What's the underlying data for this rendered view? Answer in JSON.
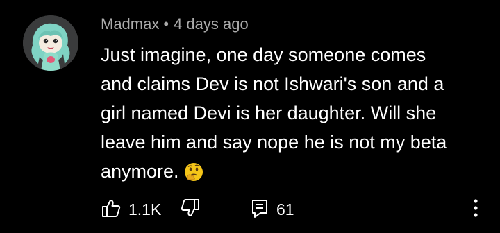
{
  "comment": {
    "author": "Madmax",
    "separator": "•",
    "timestamp": "4 days ago",
    "text_lines": [
      "Just imagine, one day someone comes",
      "and claims Dev is not Ishwari's son and a",
      "girl named Devi is her daughter. Will she",
      "leave him and say nope he is not my beta",
      "anymore."
    ],
    "emoji": "thinking-face-emoji",
    "likes": "1.1K",
    "replies": "61"
  },
  "icons": {
    "like": "thumbs-up-icon",
    "dislike": "thumbs-down-icon",
    "reply": "comment-reply-icon",
    "more": "more-vertical-icon"
  },
  "colors": {
    "background": "#000000",
    "text": "#ffffff",
    "meta": "#aaaaaa",
    "emoji": "#f5c518"
  }
}
